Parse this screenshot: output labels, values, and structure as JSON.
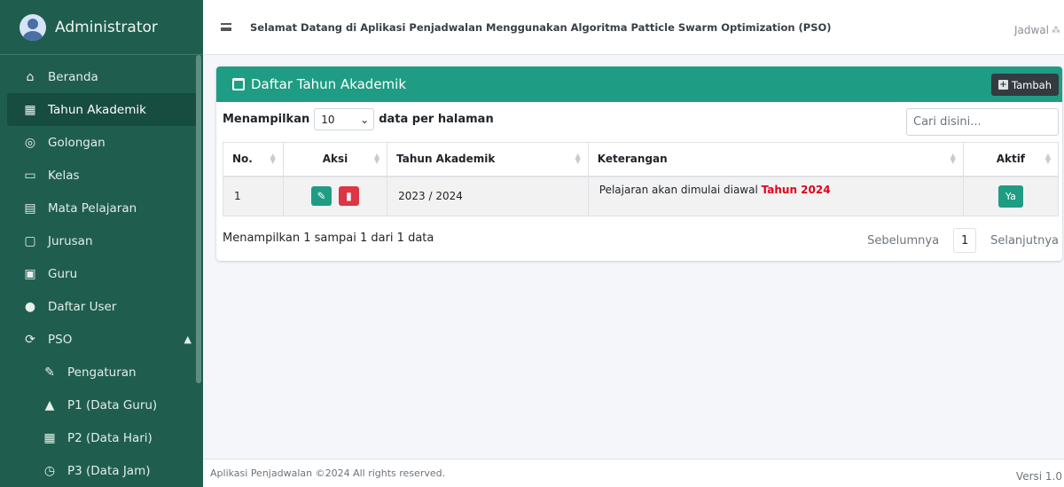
{
  "sidebar": {
    "user_name": "Administrator",
    "items": [
      {
        "label": "Beranda",
        "icon": "home-icon"
      },
      {
        "label": "Tahun Akademik",
        "icon": "calendar-icon",
        "active": true
      },
      {
        "label": "Golongan",
        "icon": "group-icon"
      },
      {
        "label": "Kelas",
        "icon": "class-icon"
      },
      {
        "label": "Mata Pelajaran",
        "icon": "book-icon"
      },
      {
        "label": "Jurusan",
        "icon": "chalkboard-teacher-icon"
      },
      {
        "label": "Guru",
        "icon": "teacher-icon"
      },
      {
        "label": "Daftar User",
        "icon": "users-icon"
      },
      {
        "label": "PSO",
        "icon": "sync-icon"
      }
    ],
    "sub_items": [
      {
        "label": "Pengaturan",
        "icon": "wrench-icon"
      },
      {
        "label": "P1 (Data Guru)",
        "icon": "user-icon"
      },
      {
        "label": "P2 (Data Hari)",
        "icon": "calendar-days-icon"
      },
      {
        "label": "P3 (Data Jam)",
        "icon": "clock-icon"
      }
    ]
  },
  "topbar": {
    "welcome": "Selamat Datang di Aplikasi Penjadwalan Menggunakan Algoritma Patticle Swarm Optimization (PSO)",
    "right_label": "Jadwal"
  },
  "card": {
    "title": "Daftar Tahun Akademik",
    "add_label": "Tambah",
    "show_prefix": "Menampilkan",
    "page_length": "10",
    "show_suffix": "data per halaman",
    "search_placeholder": "Cari disini...",
    "columns": [
      "No.",
      "Aksi",
      "Tahun Akademik",
      "Keterangan",
      "Aktif"
    ],
    "rows": [
      {
        "no": "1",
        "tahun": "2023 / 2024",
        "keterangan": "Pelajaran akan dimulai diawal ",
        "keterangan_highlight": "Tahun 2024",
        "aktif": "Ya"
      }
    ],
    "info": "Menampilkan 1 sampai 1 dari 1 data",
    "prev": "Sebelumnya",
    "page": "1",
    "next": "Selanjutnya"
  },
  "footer": {
    "copyright": "Aplikasi Penjadwalan ©2024 All rights reserved.",
    "version": "Versi 1.0"
  },
  "colors": {
    "sidebar_bg": "#1f5e4f",
    "accent": "#1f9c84",
    "danger": "#dc3545",
    "highlight_text": "#e3001b"
  }
}
